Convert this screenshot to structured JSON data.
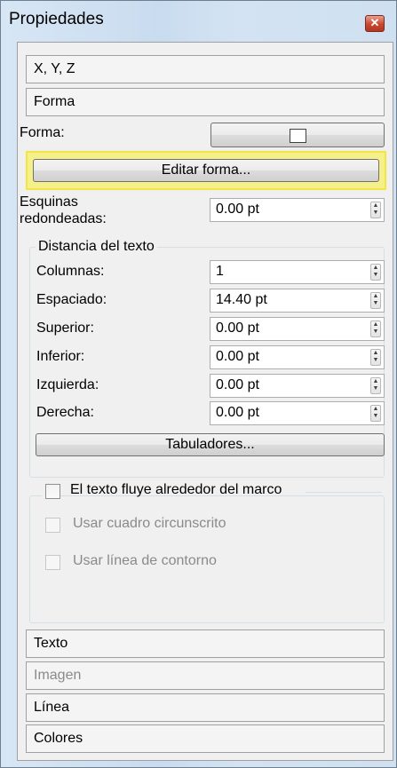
{
  "window": {
    "title": "Propiedades",
    "close_glyph": "✕"
  },
  "sections": {
    "xyz": "X, Y, Z",
    "forma": "Forma",
    "texto": "Texto",
    "imagen": "Imagen",
    "linea": "Línea",
    "colores": "Colores"
  },
  "forma": {
    "shape_label": "Forma:",
    "edit_button": "Editar forma...",
    "corners_label_1": "Esquinas",
    "corners_label_2": "redondeadas:",
    "corners_value": "0.00 pt"
  },
  "text_distance": {
    "group_title": "Distancia del texto",
    "fields": [
      {
        "label": "Columnas:",
        "value": "1"
      },
      {
        "label": "Espaciado:",
        "value": "14.40 pt"
      },
      {
        "label": "Superior:",
        "value": "0.00 pt"
      },
      {
        "label": "Inferior:",
        "value": "0.00 pt"
      },
      {
        "label": "Izquierda:",
        "value": "0.00 pt"
      },
      {
        "label": "Derecha:",
        "value": "0.00 pt"
      }
    ],
    "tabs_button": "Tabuladores..."
  },
  "text_flow": {
    "main_checkbox": "El texto fluye alrededor del marco",
    "main_checked": false,
    "bbox_checkbox": "Usar cuadro circunscrito",
    "contour_checkbox": "Usar línea de contorno"
  },
  "colors": {
    "highlight": "#f5f08a",
    "title_gradient": "#cfe0f1",
    "close": "#c9462e"
  }
}
